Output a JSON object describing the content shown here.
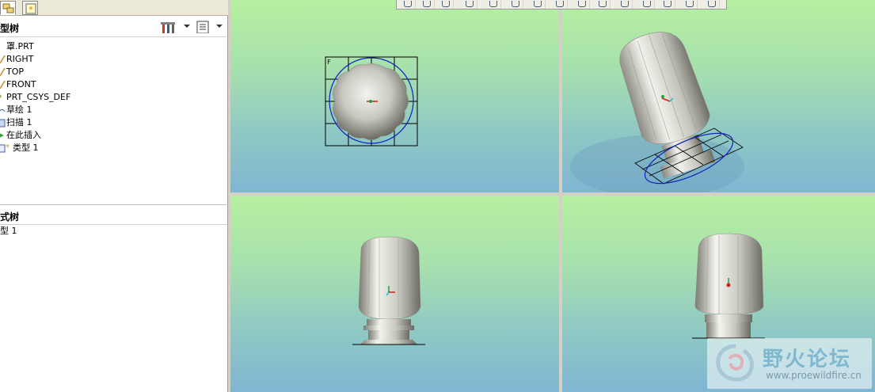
{
  "model_tree": {
    "title": "型树",
    "items": [
      {
        "label": "罩.PRT",
        "icon": "part-icon"
      },
      {
        "label": "RIGHT",
        "icon": "datum-plane-icon"
      },
      {
        "label": "TOP",
        "icon": "datum-plane-icon"
      },
      {
        "label": "FRONT",
        "icon": "datum-plane-icon"
      },
      {
        "label": "PRT_CSYS_DEF",
        "icon": "csys-icon"
      },
      {
        "label": "草绘 1",
        "icon": "sketch-icon"
      },
      {
        "label": "扫描 1",
        "icon": "sweep-icon"
      },
      {
        "label": "在此插入",
        "icon": "insert-here-icon"
      },
      {
        "label": "类型 1",
        "icon": "pattern-icon"
      }
    ]
  },
  "layer_tree": {
    "title": "式树",
    "items": [
      {
        "label": "型 1"
      }
    ]
  },
  "watermark": {
    "title": "野火论坛",
    "url": "www.proewildfire.cn"
  },
  "colors": {
    "accent": "#0000cc",
    "viewport_top": "#b6f0a0",
    "viewport_bottom": "#7fb6d2",
    "model": "#e8e8e0"
  }
}
